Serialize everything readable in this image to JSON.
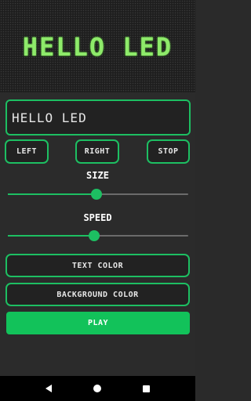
{
  "display": {
    "text": "HELLO LED"
  },
  "input": {
    "value": "HELLO LED"
  },
  "controls": {
    "left": "LEFT",
    "right": "RIGHT",
    "stop": "STOP"
  },
  "size": {
    "label": "SIZE",
    "value": 0.49
  },
  "speed": {
    "label": "SPEED",
    "value": 0.48
  },
  "buttons": {
    "text_color": "TEXT COLOR",
    "background_color": "BACKGROUND COLOR",
    "play": "PLAY"
  },
  "colors": {
    "accent": "#1dbf62",
    "led": "#8eea6a",
    "background": "#2b2b2b"
  },
  "navbar": {
    "back_icon": "back-triangle-icon",
    "home_icon": "home-circle-icon",
    "recents_icon": "recents-square-icon"
  }
}
